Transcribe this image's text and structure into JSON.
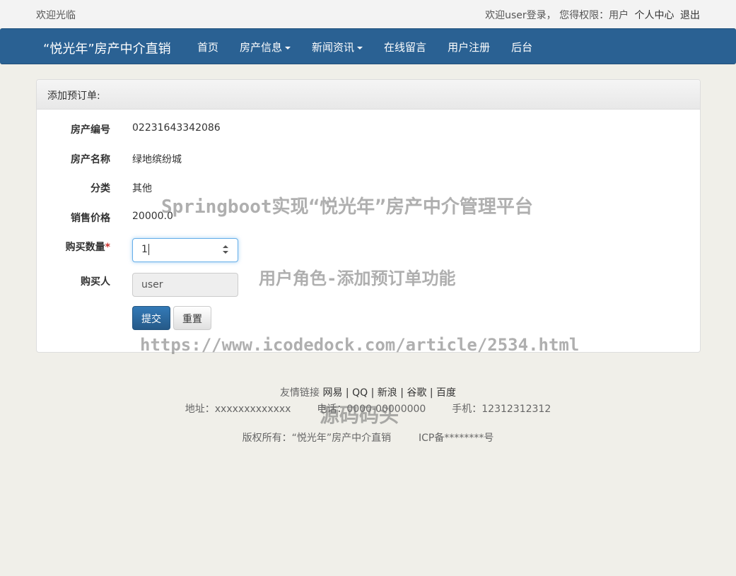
{
  "topbar": {
    "welcome": "欢迎光临",
    "login_info": "欢迎user登录， 您得权限：用户",
    "personal_center": "个人中心",
    "logout": "退出"
  },
  "navbar": {
    "brand": "“悦光年”房产中介直销",
    "items": [
      "首页",
      "房产信息",
      "新闻资讯",
      "在线留言",
      "用户注册",
      "后台"
    ]
  },
  "panel": {
    "heading": "添加预订单:",
    "fields": {
      "house_no": {
        "label": "房产编号",
        "value": "02231643342086"
      },
      "house_name": {
        "label": "房产名称",
        "value": "绿地缤纷城"
      },
      "category": {
        "label": "分类",
        "value": "其他"
      },
      "price": {
        "label": "销售价格",
        "value": "20000.0"
      },
      "quantity": {
        "label": "购买数量",
        "required_mark": "*",
        "value": "1"
      },
      "buyer": {
        "label": "购买人",
        "value": "user"
      }
    },
    "submit_label": "提交",
    "reset_label": "重置"
  },
  "footer": {
    "links_label": "友情链接",
    "links": [
      "网易 |",
      "QQ |",
      "新浪 |",
      "谷歌 |",
      "百度"
    ],
    "address": "地址：xxxxxxxxxxxxx",
    "phone": "电话：0000-00000000",
    "mobile": "手机：12312312312",
    "copyright": "版权所有：“悦光年”房产中介直销",
    "icp": "ICP备********号"
  },
  "watermarks": {
    "line1": "Springboot实现“悦光年”房产中介管理平台",
    "line2": "用户角色-添加预订单功能",
    "url": "https://www.icodedock.com/article/2534.html",
    "brand": "源码码头"
  },
  "colors": {
    "navbar": "#2a6193",
    "page_background": "#f0efe9",
    "primary_button": "#2e6da4"
  }
}
